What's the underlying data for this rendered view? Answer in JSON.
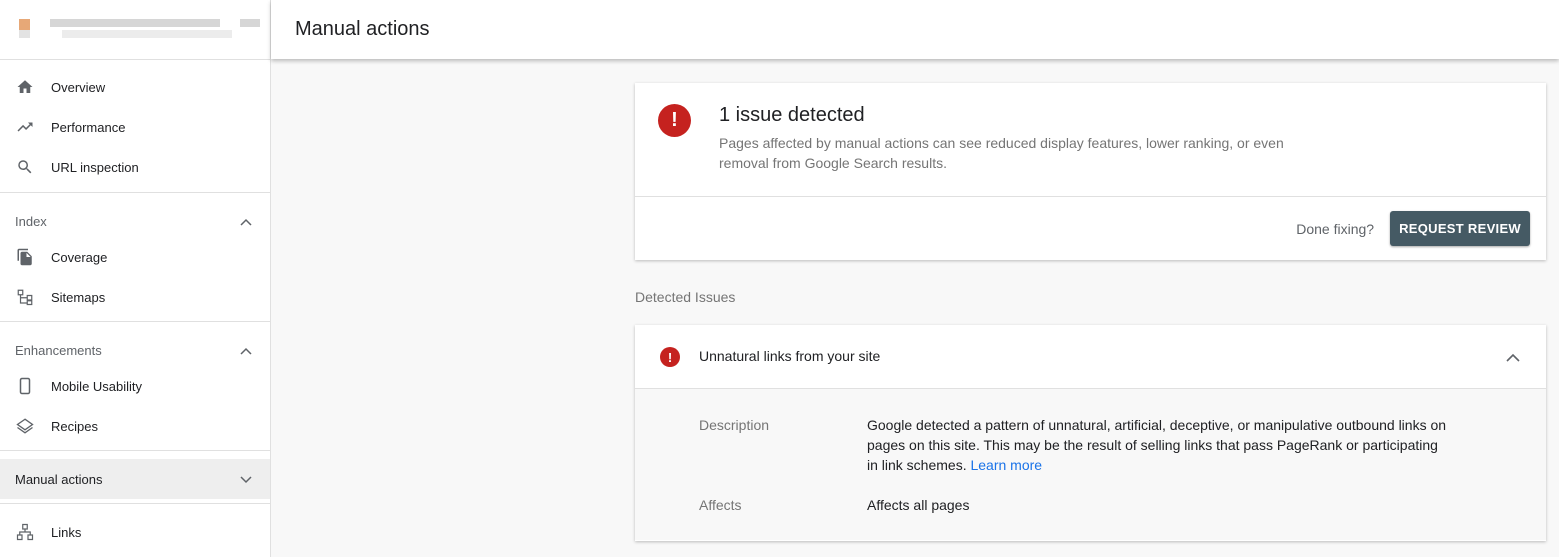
{
  "header": {
    "title": "Manual actions"
  },
  "sidebar": {
    "top_items": [
      {
        "label": "Overview",
        "icon": "home-icon"
      },
      {
        "label": "Performance",
        "icon": "trending-up-icon"
      },
      {
        "label": "URL inspection",
        "icon": "search-icon"
      }
    ],
    "index": {
      "label": "Index",
      "items": [
        {
          "label": "Coverage",
          "icon": "copy-icon"
        },
        {
          "label": "Sitemaps",
          "icon": "sitemap-icon"
        }
      ]
    },
    "enhancements": {
      "label": "Enhancements",
      "items": [
        {
          "label": "Mobile Usability",
          "icon": "phone-icon"
        },
        {
          "label": "Recipes",
          "icon": "layers-icon"
        }
      ]
    },
    "manual_actions": {
      "label": "Manual actions"
    },
    "links": {
      "label": "Links",
      "icon": "links-icon"
    }
  },
  "summary": {
    "title": "1 issue detected",
    "description": "Pages affected by manual actions can see reduced display features, lower ranking, or even removal from Google Search results.",
    "done_label": "Done fixing?",
    "button_label": "REQUEST REVIEW"
  },
  "detected_label": "Detected Issues",
  "issue": {
    "title": "Unnatural links from your site",
    "description_label": "Description",
    "description_text": "Google detected a pattern of unnatural, artificial, deceptive, or manipulative outbound links on pages on this site. This may be the result of selling links that pass PageRank or participating in link schemes.",
    "learn_more": "Learn more",
    "affects_label": "Affects",
    "affects_value": "Affects all pages"
  },
  "colors": {
    "error": "#c5221f",
    "button": "#455a64",
    "link": "#1a73e8"
  }
}
